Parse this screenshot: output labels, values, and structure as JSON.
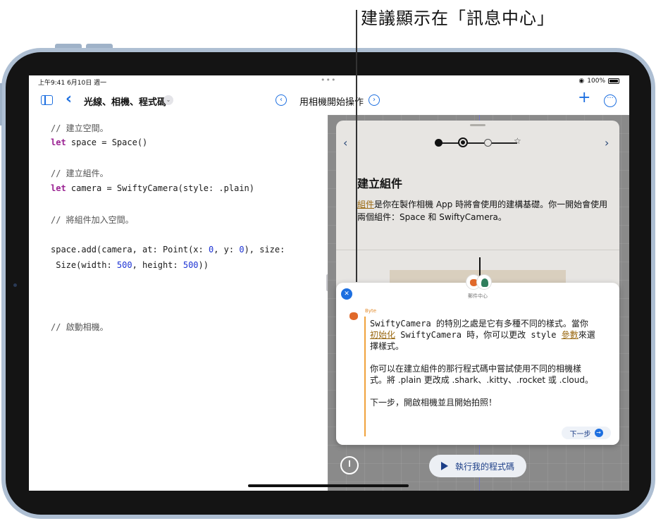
{
  "callout": {
    "text": "建議顯示在「訊息中心」"
  },
  "status_bar": {
    "time": "上午9:41  6月10日 週一",
    "dots": "•••",
    "battery": "100%"
  },
  "navbar": {
    "title": "光線、相機、程式碼",
    "page_title": "用相機開始操作",
    "prev_symbol": "‹",
    "next_symbol": "›",
    "plus_symbol": "+",
    "more_symbol": "···",
    "back_symbol": "‹",
    "chevron_symbol": "⌄"
  },
  "code": {
    "lines": [
      {
        "type": "comment",
        "text": "// 建立空間。"
      },
      {
        "type": "code",
        "kw": "let",
        "text": " space = Space()"
      },
      {
        "type": "comment",
        "text": "// 建立組件。"
      },
      {
        "type": "code",
        "kw": "let",
        "text": " camera = SwiftyCamera(style: .plain)"
      },
      {
        "type": "comment",
        "text": "// 將組件加入空間。"
      },
      {
        "type": "code",
        "text_a": "space.add(camera, at: Point(x: ",
        "n1": "0",
        "text_b": ", y: ",
        "n2": "0",
        "text_c": "), size:"
      },
      {
        "type": "code",
        "text_a": " Size(width: ",
        "n1": "500",
        "text_b": ", height: ",
        "n2": "500",
        "text_c": "))"
      },
      {
        "type": "comment",
        "text": "// 啟動相機。"
      }
    ]
  },
  "guide": {
    "heading": "建立組件",
    "body_link": "組件",
    "body_rest": "是你在製作相機 App 時將會使用的建構基礎。你一開始會使用兩個組件：Space 和 SwiftyCamera。",
    "prev_symbol": "‹",
    "next_symbol": "›",
    "star_symbol": "☆"
  },
  "run": {
    "label": "執行我的程式碼"
  },
  "message": {
    "center_label": "郵件中心",
    "sender": "Byte",
    "close_symbol": "✕",
    "p1_a": "SwiftyCamera 的特別之處是它有多種不同的樣式。當你",
    "p1_link1": "初始化",
    "p1_b": " SwiftyCamera 時，你可以更改 style ",
    "p1_link2": "參數",
    "p1_c": "來選擇樣式。",
    "p2": "你可以在建立組件的那行程式碼中嘗試使用不同的相機樣式。將 .plain 更改成 .shark、.kitty、.rocket 或 .cloud。",
    "p3": "下一步，開啟相機並且開始拍照！",
    "next_label": "下一步",
    "next_symbol": "→"
  }
}
